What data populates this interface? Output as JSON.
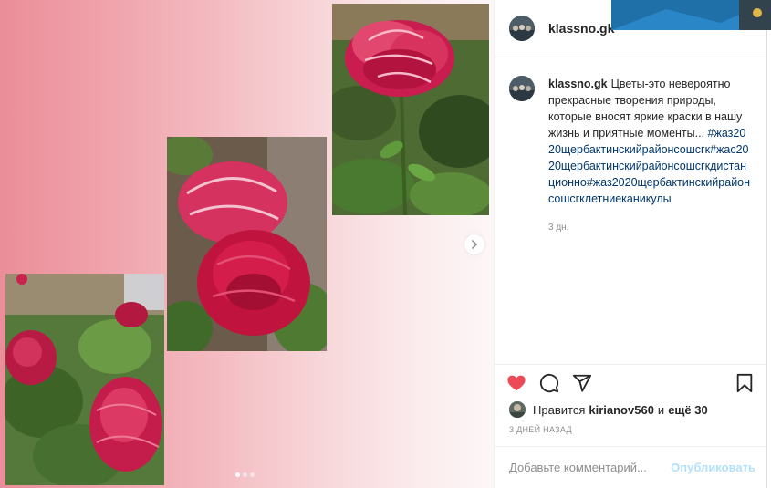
{
  "post": {
    "author": "klassno.gk",
    "caption_text": "Цветы-это невероятно прекрасные творения природы, которые вносят яркие краски в нашу жизнь и приятные моменты...",
    "caption_hashtags": "#жаз2020щербактинскийрайонсошсгк#жас2020щербактинскийрайонсошсгкдистанционно#жаз2020щербактинскийрайонсошсгклетниеканикулы",
    "caption_time": "3 дн.",
    "likes_prefix": "Нравится",
    "likes_user": "kirianov560",
    "likes_and": "и",
    "likes_more": "ещё 30",
    "date": "3 дней назад",
    "comment_placeholder": "Добавьте комментарий...",
    "publish_label": "Опубликовать"
  },
  "carousel": {
    "current": 1,
    "total": 3
  },
  "icons": {
    "like": "heart-icon",
    "comment": "comment-icon",
    "share": "share-icon",
    "save": "bookmark-icon",
    "next": "chevron-right-icon"
  },
  "colors": {
    "like": "#ed4956",
    "hashtag": "#00376b",
    "publish_disabled": "#b2dffc"
  }
}
